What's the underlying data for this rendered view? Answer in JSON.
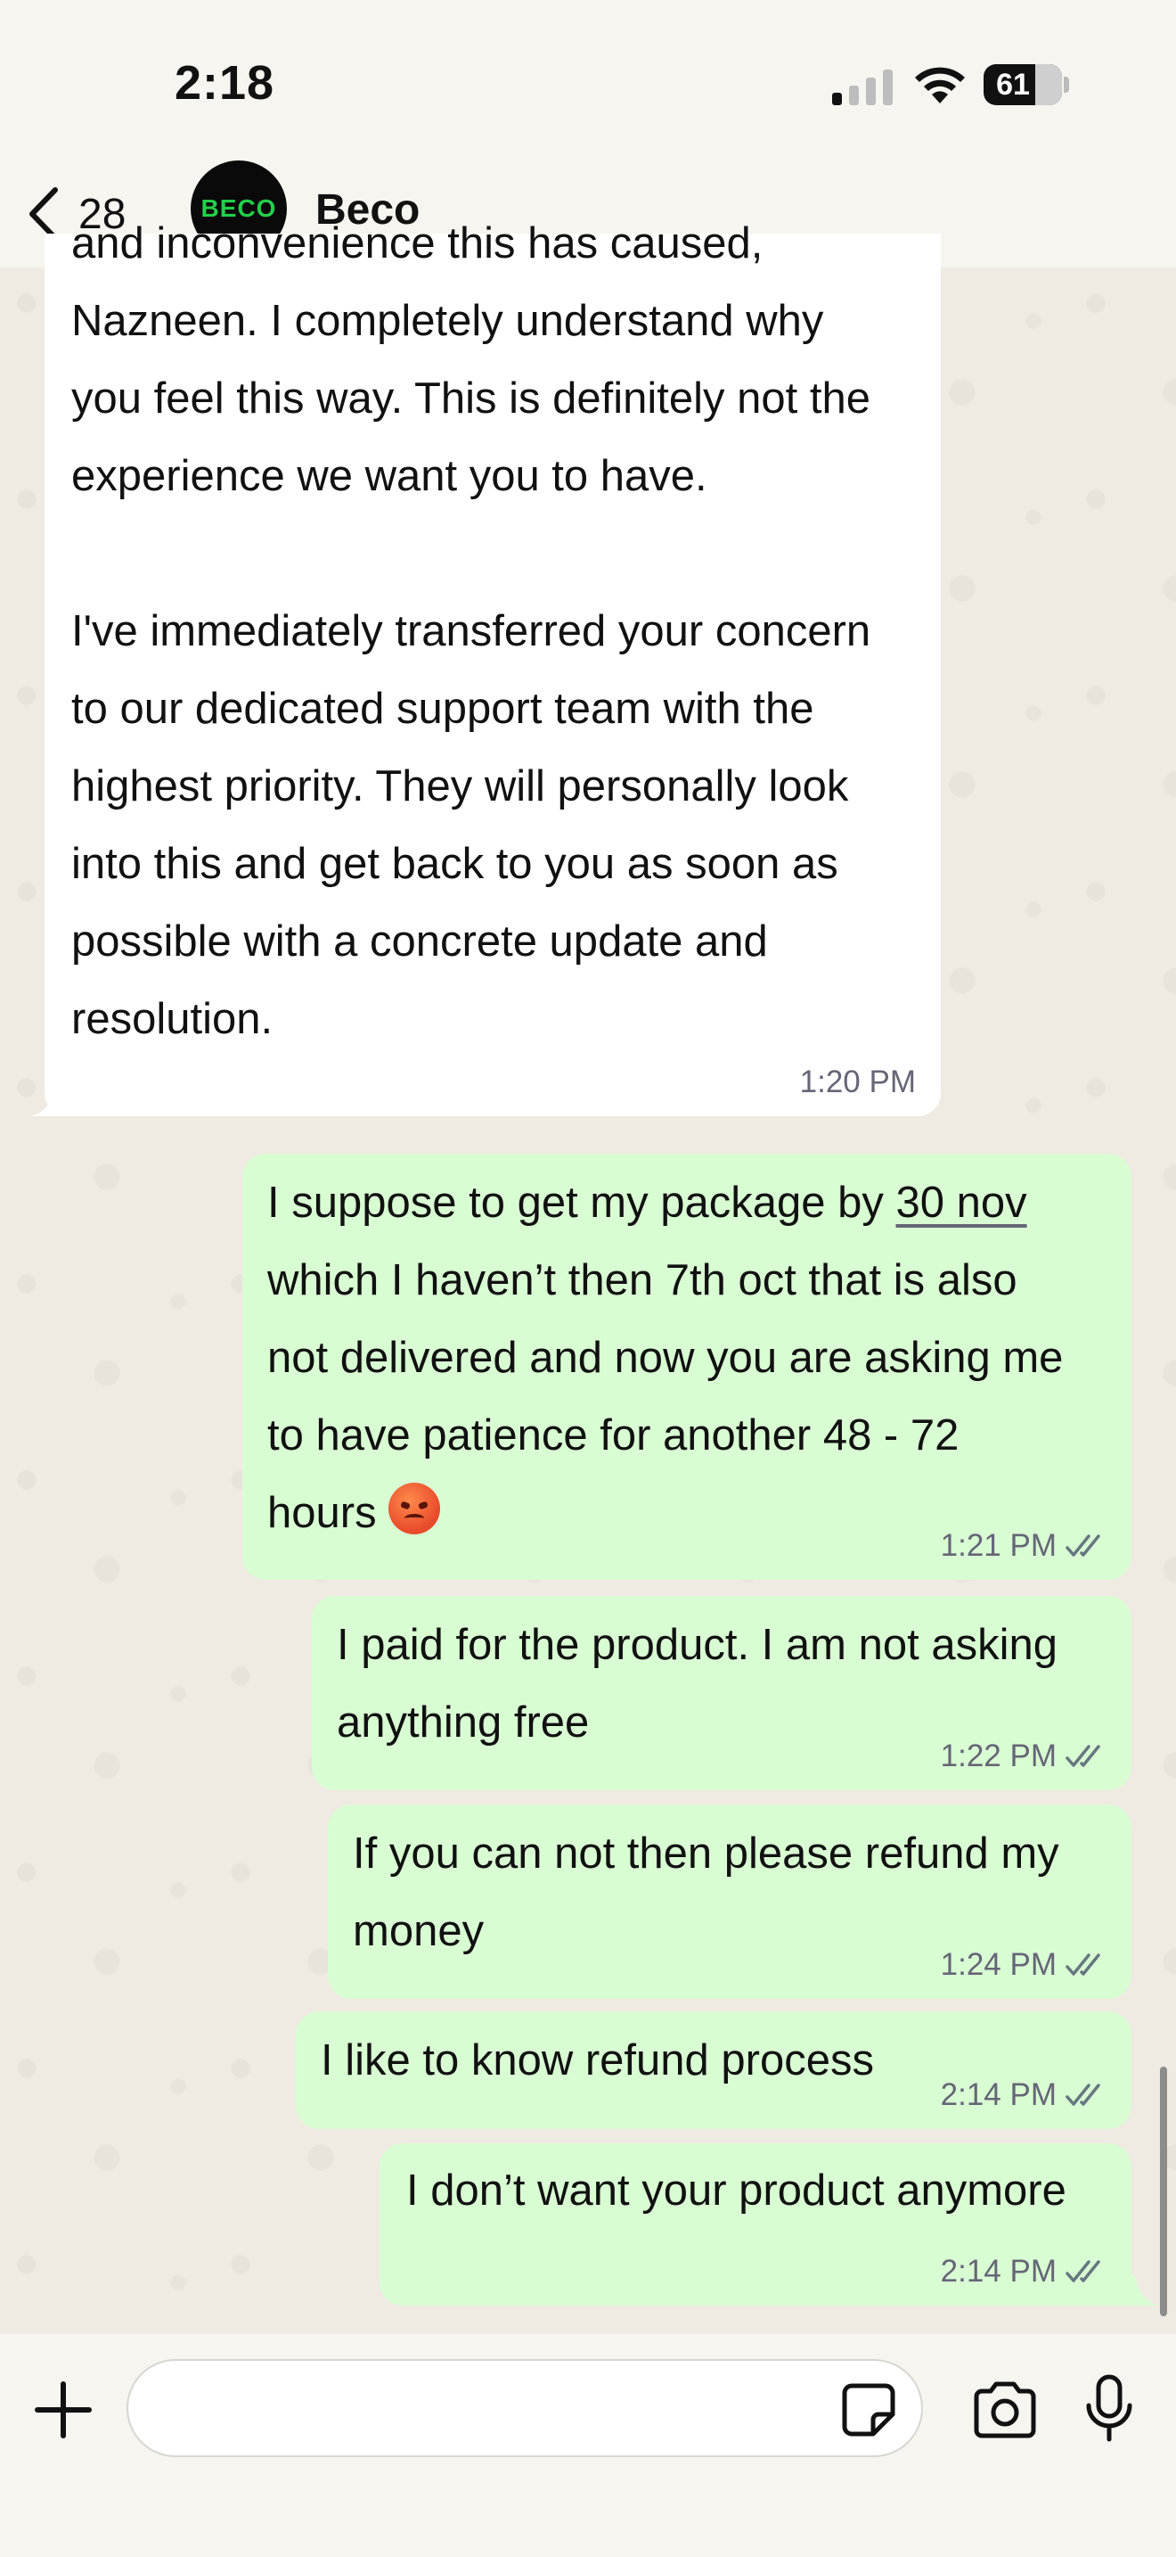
{
  "status_bar": {
    "time": "2:18",
    "battery": "61",
    "signal_icon": "cellular-signal-icon",
    "wifi_icon": "wifi-icon"
  },
  "header": {
    "back_count": "28",
    "avatar_text": "BECO",
    "contact_name": "Beco"
  },
  "messages": [
    {
      "direction": "incoming",
      "text": "and inconvenience this has caused,\nNazneen. I completely understand why\nyou feel this way. This is definitely not the\nexperience we want you to have.\n\nI've immediately transferred your concern\nto our dedicated support team with the\nhighest priority. They will personally look\ninto this and get back to you as soon as\npossible with a concrete update and\nresolution.",
      "time": "1:20 PM"
    },
    {
      "direction": "outgoing",
      "text_before": "I suppose to get my package by ",
      "link_text": "30 nov",
      "text_after": "\nwhich I haven’t then 7th oct that is also\nnot delivered and now you are asking me\nto have patience for another 48 - 72\nhours ",
      "emoji": "angry-face-emoji",
      "time": "1:21 PM",
      "read": true
    },
    {
      "direction": "outgoing",
      "text": "I paid for the product. I am not asking\nanything free",
      "time": "1:22 PM",
      "read": true
    },
    {
      "direction": "outgoing",
      "text": "If you can not then please refund my\nmoney",
      "time": "1:24 PM",
      "read": true
    },
    {
      "direction": "outgoing",
      "text": "I like to know refund process",
      "time": "2:14 PM",
      "read": true
    },
    {
      "direction": "outgoing",
      "text": "I don’t want your product anymore",
      "time": "2:14 PM",
      "read": true
    }
  ],
  "input_bar": {
    "placeholder": "",
    "value": ""
  },
  "colors": {
    "outgoing_bubble": "#d9fdd3",
    "incoming_bubble": "#ffffff",
    "read_ticks": "#667781",
    "chat_background": "#efeae2",
    "brand_green": "#22d04a"
  }
}
